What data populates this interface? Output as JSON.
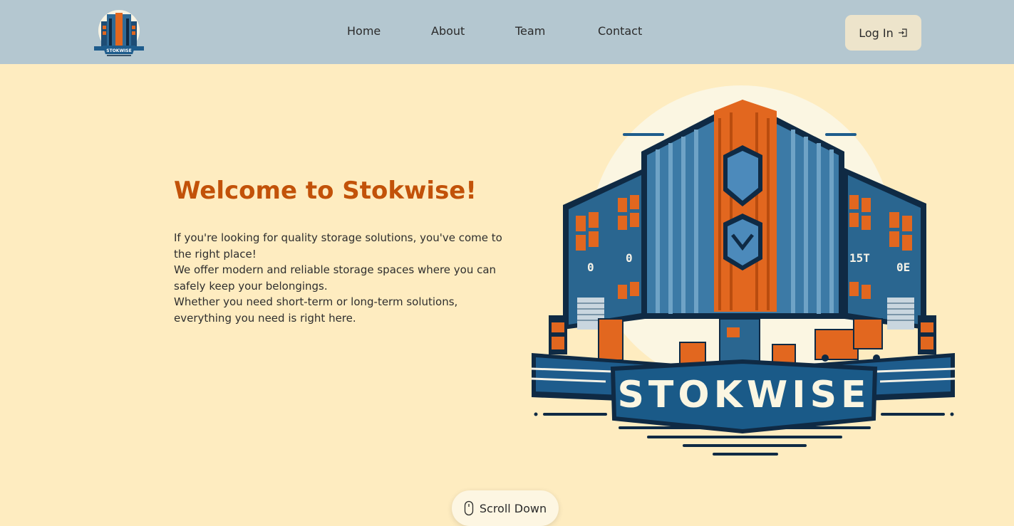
{
  "header": {
    "logo_text": "STOKWISE",
    "nav": [
      {
        "label": "Home"
      },
      {
        "label": "About"
      },
      {
        "label": "Team"
      },
      {
        "label": "Contact"
      }
    ],
    "login_label": "Log In"
  },
  "hero": {
    "title": "Welcome to Stokwise!",
    "paragraphs": [
      "If you're looking for quality storage solutions, you've come to the right place!",
      "We offer modern and reliable storage spaces where you can safely keep your belongings.",
      "Whether you need short-term or long-term solutions, everything you need is right here."
    ],
    "illustration_text": "STOKWISE",
    "building_signs": [
      "0",
      "0",
      "15T",
      "0E"
    ]
  },
  "scroll_label": "Scroll Down",
  "colors": {
    "nav_bg": "#b4c7d0",
    "page_bg": "#feecc0",
    "title": "#c25209",
    "accent_orange": "#e2671f",
    "accent_blue": "#1e5c8c",
    "dark_navy": "#0f2a44"
  },
  "icons": {
    "login": "login-icon",
    "scroll": "mouse-icon"
  }
}
